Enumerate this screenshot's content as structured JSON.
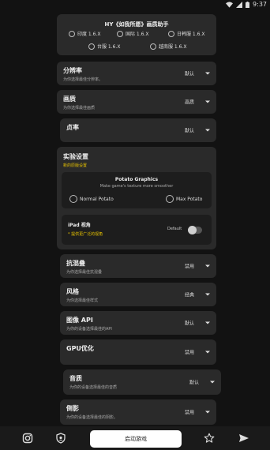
{
  "status": {
    "time": "9:37"
  },
  "header": {
    "title": "HY《如我所愿》画质助手",
    "regions": [
      "印度 1.6.X",
      "国际 1.6.X",
      "日韩服 1.6.X",
      "台服 1.6.X",
      "越南服 1.6.X"
    ]
  },
  "resolution": {
    "title": "分辨率",
    "desc": "为你选择最佳分辨率。",
    "value": "默认"
  },
  "quality": {
    "title": "画质",
    "desc": "为你选择最佳画质",
    "value": "高质"
  },
  "framerate": {
    "title": "贞率",
    "value": "默认"
  },
  "experimental": {
    "title": "实验设置",
    "desc": "新的原版设置",
    "potato": {
      "title": "Potato Graphics",
      "desc": "Make game's texture more smoother",
      "options": [
        "Normal Potato",
        "Max Potato"
      ]
    },
    "ipad": {
      "title": "iPad 视角",
      "desc": "* 提供更广泛的视角",
      "toggle_label": "Default"
    }
  },
  "antialias": {
    "title": "抗混叠",
    "desc": "为你选择最佳抗混叠",
    "value": "禁用"
  },
  "style": {
    "title": "风格",
    "desc": "为你选择最佳样式",
    "value": "经典"
  },
  "graphics_api": {
    "title": "图像 API",
    "desc": "为你的设备选择最佳的API",
    "value": "默认"
  },
  "gpu": {
    "title": "GPU优化",
    "value": "禁用"
  },
  "sound": {
    "title": "音质",
    "desc": "为你的设备选择最佳的音质",
    "value": "默认"
  },
  "shadow": {
    "title": "倒影",
    "desc": "为你的设备选择最佳的阴影。",
    "value": "禁用"
  },
  "bottom": {
    "start_label": "启动游戏"
  }
}
